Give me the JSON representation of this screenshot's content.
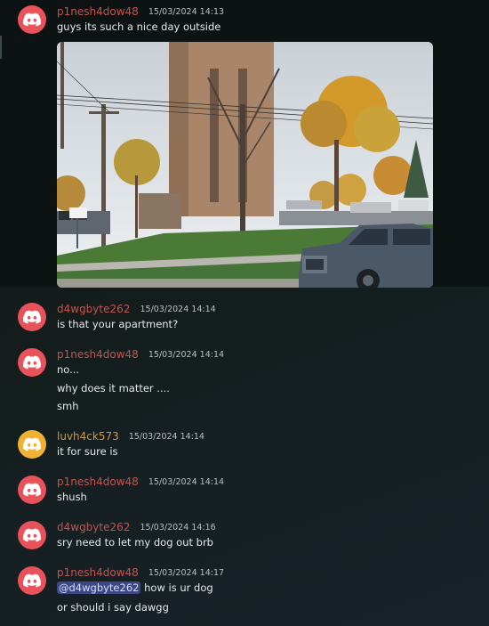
{
  "colors": {
    "discord_red": "#e8525a",
    "discord_yellow": "#f0b233",
    "username_red": "#c3544d",
    "username_yellow": "#cf9a3a",
    "mention_bg": "#3d4784"
  },
  "messages": [
    {
      "username": "p1nesh4dow48",
      "timestamp": "15/03/2024 14:13",
      "avatar_color": "red",
      "avatar_icon": "discord-logo-icon",
      "lines": [
        "guys its such a nice day outside"
      ],
      "attachment": {
        "type": "image",
        "subject": "street-photo"
      }
    },
    {
      "username": "d4wgbyte262",
      "timestamp": "15/03/2024 14:14",
      "avatar_color": "red",
      "avatar_icon": "discord-logo-icon",
      "lines": [
        "is that your apartment?"
      ]
    },
    {
      "username": "p1nesh4dow48",
      "timestamp": "15/03/2024 14:14",
      "avatar_color": "red",
      "avatar_icon": "discord-logo-icon",
      "lines": [
        "no...",
        "why does it matter ....",
        "smh"
      ]
    },
    {
      "username": "luvh4ck573",
      "timestamp": "15/03/2024 14:14",
      "avatar_color": "yellow",
      "avatar_icon": "discord-logo-icon",
      "lines": [
        "it for sure is"
      ]
    },
    {
      "username": "p1nesh4dow48",
      "timestamp": "15/03/2024 14:14",
      "avatar_color": "red",
      "avatar_icon": "discord-logo-icon",
      "lines": [
        "shush"
      ]
    },
    {
      "username": "d4wgbyte262",
      "timestamp": "15/03/2024 14:16",
      "avatar_color": "red",
      "avatar_icon": "discord-logo-icon",
      "lines": [
        "sry need to let my dog out brb"
      ]
    },
    {
      "username": "p1nesh4dow48",
      "timestamp": "15/03/2024 14:17",
      "avatar_color": "red",
      "avatar_icon": "discord-logo-icon",
      "mention": "@d4wgbyte262",
      "lines": [
        "how is ur dog",
        "or should i say dawgg"
      ]
    }
  ]
}
